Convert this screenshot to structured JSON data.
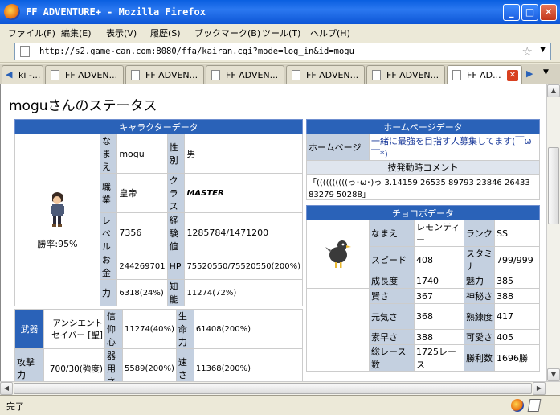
{
  "window": {
    "title": "FF ADVENTURE+ - Mozilla Firefox",
    "min": "_",
    "max": "□",
    "close": "✕"
  },
  "menu": [
    "ファイル(F)",
    "編集(E)",
    "表示(V)",
    "履歴(S)",
    "ブックマーク(B)",
    "ツール(T)",
    "ヘルプ(H)"
  ],
  "url": "http://s2.game-can.com:8080/ffa/kairan.cgi?mode=log_in&id=mogu",
  "tabs": [
    {
      "label": "ki -..."
    },
    {
      "label": "FF ADVEN..."
    },
    {
      "label": "FF ADVEN..."
    },
    {
      "label": "FF ADVEN..."
    },
    {
      "label": "FF ADVEN..."
    },
    {
      "label": "FF ADVEN..."
    },
    {
      "label": "FF AD..."
    }
  ],
  "page": {
    "title": "moguさんのステータス",
    "char": {
      "header": "キャラクターデータ",
      "winrate": "勝率:95%",
      "name_l": "なまえ",
      "name_v": "mogu",
      "sex_l": "性別",
      "sex_v": "男",
      "job_l": "職業",
      "job_v": "皇帝",
      "class_l": "クラス",
      "class_v": "MASTER",
      "level_l": "レベル",
      "level_v": "7356",
      "exp_l": "経験値",
      "exp_v": "1285784/1471200",
      "gold_l": "お金",
      "gold_v": "244269701",
      "hp_l": "HP",
      "hp_v": "75520550/75520550(200%)",
      "str_l": "力",
      "str_v": "6318(24%)",
      "int_l": "知能",
      "int_v": "11274(72%)",
      "weapon_l": "武器",
      "weapon_v": "アンシエント セイバー [聖]",
      "faith_l": "信仰心",
      "faith_v": "11274(40%)",
      "vit_l": "生命力",
      "vit_v": "61408(200%)",
      "atk_l": "攻撃力",
      "atk_v": "700/30(強度)",
      "dex_l": "器用さ",
      "dex_v": "5589(200%)",
      "spd_l": "速さ",
      "spd_v": "11368(200%)"
    },
    "home": {
      "header": "ホームページデータ",
      "hp_l": "ホームページ",
      "hp_v": "一緒に最強を目指す人募集してます(￣ω￣*)",
      "comment_h": "技発動時コメント",
      "comment_v": "「((((((((((っ･ω･)っ 3.14159 26535 89793 23846 26433 83279 50288」"
    },
    "choco": {
      "header": "チョコボデータ",
      "name_l": "なまえ",
      "name_v": "レモンティー",
      "rank_l": "ランク",
      "rank_v": "SS",
      "speed_l": "スピード",
      "speed_v": "408",
      "stamina_l": "スタミナ",
      "stamina_v": "799/999",
      "growth_l": "成長度",
      "growth_v": "1740",
      "charm_l": "魅力",
      "charm_v": "385",
      "wise_l": "賢さ",
      "wise_v": "367",
      "myst_l": "神秘さ",
      "myst_v": "388",
      "energy_l": "元気さ",
      "energy_v": "368",
      "skill_l": "熟練度",
      "skill_v": "417",
      "quick_l": "素早さ",
      "quick_v": "388",
      "cute_l": "可愛さ",
      "cute_v": "405",
      "race_l": "総レース数",
      "race_v": "1725レース",
      "wins_l": "勝利数",
      "wins_v": "1696勝"
    }
  },
  "status": "完了"
}
